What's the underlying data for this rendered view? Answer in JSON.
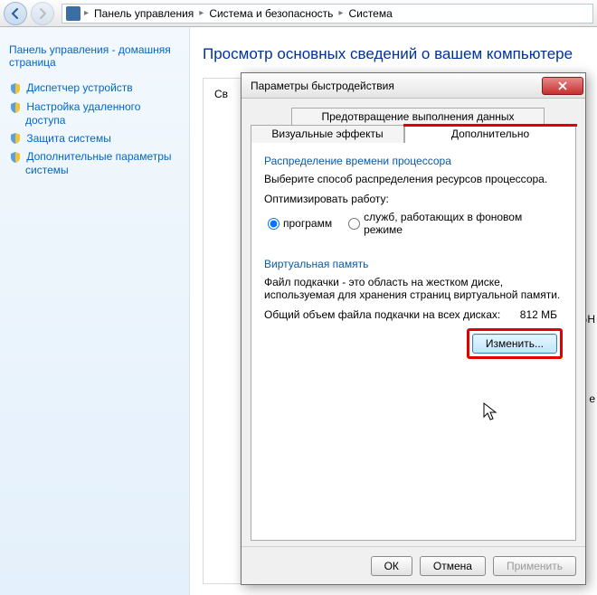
{
  "breadcrumb": {
    "items": [
      "Панель управления",
      "Система и безопасность",
      "Система"
    ]
  },
  "sidebar": {
    "home": "Панель управления - домашняя страница",
    "items": [
      "Диспетчер устройств",
      "Настройка удаленного доступа",
      "Защита системы",
      "Дополнительные параметры системы"
    ]
  },
  "page_title": "Просмотр основных сведений о вашем компьютере",
  "dialog": {
    "title": "Параметры быстродействия",
    "tabs": {
      "top": "Предотвращение выполнения данных",
      "left": "Визуальные эффекты",
      "right": "Дополнительно"
    },
    "cpu": {
      "title": "Распределение времени процессора",
      "desc": "Выберите способ распределения ресурсов процессора.",
      "opt_label": "Оптимизировать работу:",
      "opt_programs": "программ",
      "opt_services": "служб, работающих в фоновом режиме"
    },
    "vm": {
      "title": "Виртуальная память",
      "desc": "Файл подкачки - это область на жестком диске, используемая для хранения страниц виртуальной памяти.",
      "total_label": "Общий объем файла подкачки на всех дисках:",
      "total_value": "812 МБ",
      "change_btn": "Изменить..."
    },
    "buttons": {
      "ok": "ОК",
      "cancel": "Отмена",
      "apply": "Применить"
    }
  },
  "peek": {
    "gh": "GH",
    "e": "e"
  },
  "content_prefix": "Св"
}
